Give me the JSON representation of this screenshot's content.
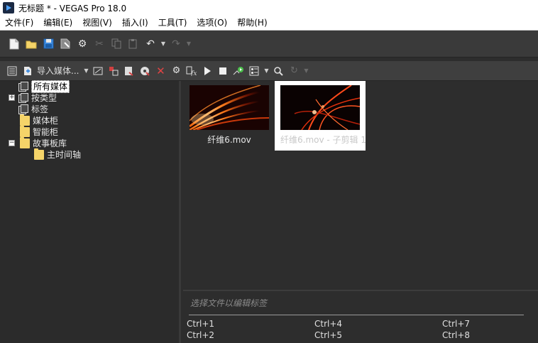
{
  "window": {
    "title": "无标题 * - VEGAS Pro 18.0"
  },
  "menu": {
    "items": [
      "文件(F)",
      "编辑(E)",
      "视图(V)",
      "插入(I)",
      "工具(T)",
      "选项(O)",
      "帮助(H)"
    ]
  },
  "toolbar_main": {
    "icons": [
      "new-file-icon",
      "open-folder-icon",
      "save-icon",
      "render-icon",
      "settings-gear-icon",
      "cut-icon",
      "copy-icon",
      "paste-icon",
      "undo-icon",
      "undo-history-icon",
      "redo-icon",
      "redo-history-icon"
    ]
  },
  "media_toolbar": {
    "import_label": "导入媒体..."
  },
  "tree": {
    "nodes": [
      {
        "label": "所有媒体",
        "selected": true
      },
      {
        "label": "按类型"
      },
      {
        "label": "标签"
      },
      {
        "label": "媒体柜"
      },
      {
        "label": "智能柜"
      },
      {
        "label": "故事板库"
      },
      {
        "label": "主时间轴"
      }
    ],
    "expanders": [
      "+",
      "−"
    ]
  },
  "media": {
    "items": [
      {
        "caption": "纤维6.mov"
      },
      {
        "caption": "纤维6.mov - 子剪辑 1"
      }
    ]
  },
  "tags": {
    "hint": "选择文件以编辑标签",
    "shortcuts": [
      "Ctrl+1",
      "Ctrl+4",
      "Ctrl+7",
      "Ctrl+2",
      "Ctrl+5",
      "Ctrl+8"
    ]
  }
}
